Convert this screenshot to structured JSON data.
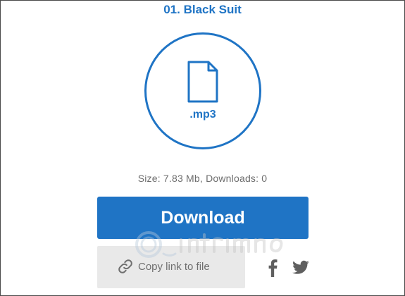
{
  "file": {
    "title": "01. Black Suit",
    "extension": ".mp3",
    "meta": "Size: 7.83 Mb, Downloads: 0"
  },
  "actions": {
    "download_label": "Download",
    "copy_link_label": "Copy link to file"
  },
  "icons": {
    "file": "document-icon",
    "link": "link-icon",
    "facebook": "facebook-icon",
    "twitter": "twitter-icon"
  },
  "colors": {
    "accent": "#1f74c5",
    "download_bg": "#1f74c5",
    "copy_bg": "#e9e9e9",
    "meta_text": "#6d6d6d",
    "social_icons": "#5f5f5f"
  }
}
